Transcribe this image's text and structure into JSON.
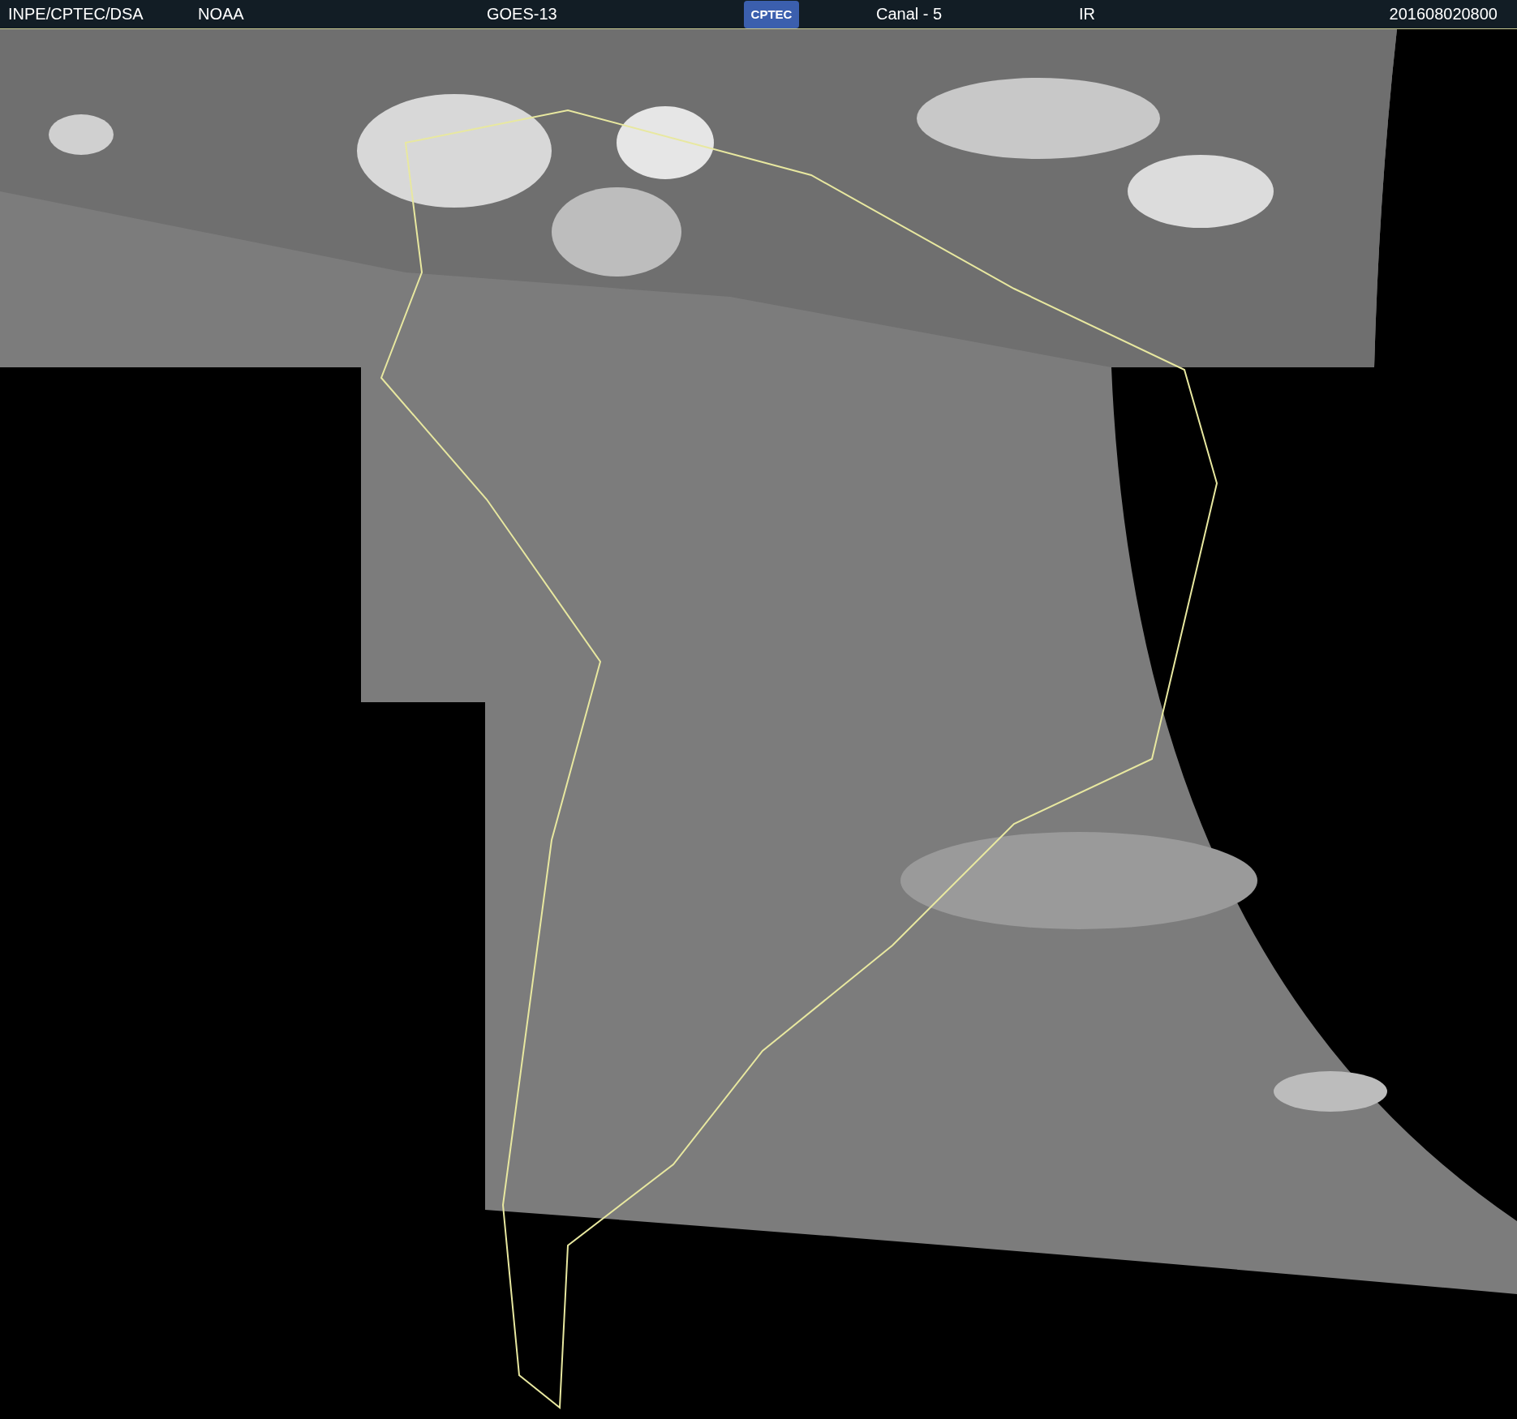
{
  "header": {
    "items": [
      {
        "kind": "text",
        "text": "INPE/CPTEC/DSA"
      },
      {
        "kind": "text",
        "text": "NOAA"
      },
      {
        "kind": "text",
        "text": "GOES-13"
      },
      {
        "kind": "logo",
        "text": "CPTEC"
      },
      {
        "kind": "text",
        "text": "Canal - 5"
      },
      {
        "kind": "text",
        "text": "IR"
      },
      {
        "kind": "text",
        "text": "201608020800"
      }
    ]
  }
}
